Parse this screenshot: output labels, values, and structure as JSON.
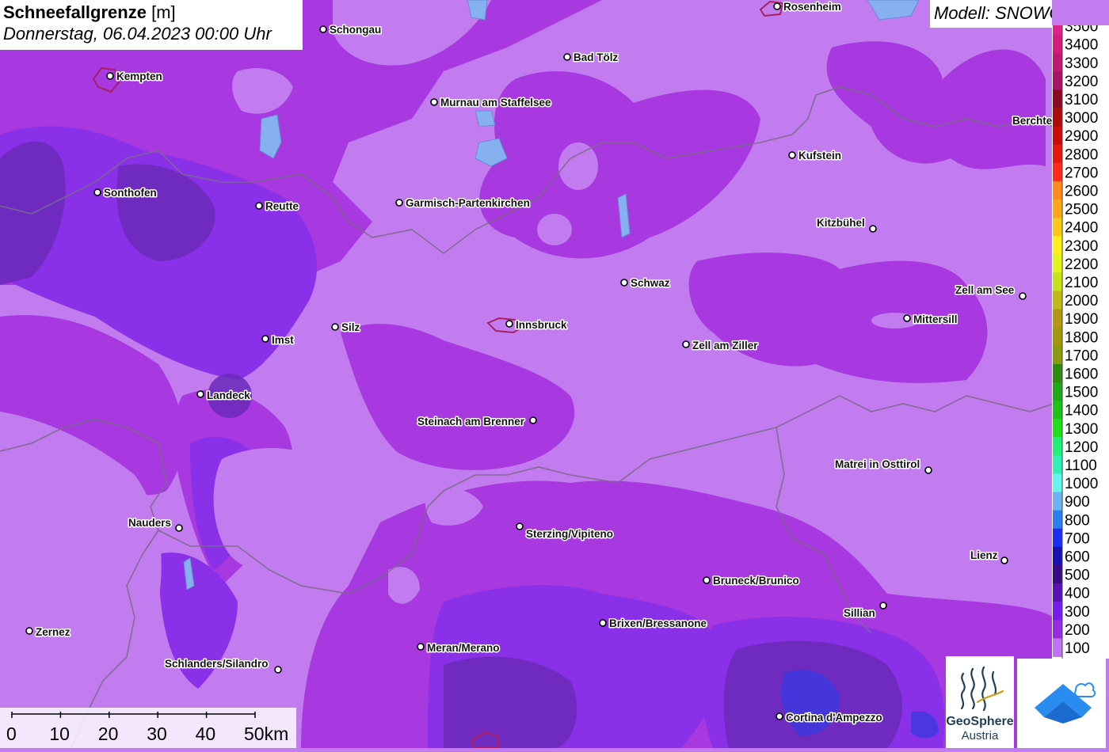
{
  "header": {
    "title": "Schneefallgrenze",
    "unit": "[m]",
    "date": "Donnerstag, 06.04.2023 00:00 Uhr",
    "model": "Modell: SNOWGRID"
  },
  "legend": {
    "entries": [
      {
        "label": "3500",
        "color": "#e0218a"
      },
      {
        "label": "3400",
        "color": "#d41c7f"
      },
      {
        "label": "3300",
        "color": "#c21675"
      },
      {
        "label": "3200",
        "color": "#a8126a"
      },
      {
        "label": "3100",
        "color": "#8c0a20"
      },
      {
        "label": "3000",
        "color": "#ad0b0b"
      },
      {
        "label": "2900",
        "color": "#cc0a0a"
      },
      {
        "label": "2800",
        "color": "#e5170f"
      },
      {
        "label": "2700",
        "color": "#ff2a1a"
      },
      {
        "label": "2600",
        "color": "#ff8a1a"
      },
      {
        "label": "2500",
        "color": "#ffa51a"
      },
      {
        "label": "2400",
        "color": "#ffc71a"
      },
      {
        "label": "2300",
        "color": "#ffee1a"
      },
      {
        "label": "2200",
        "color": "#e2f51a"
      },
      {
        "label": "2100",
        "color": "#c8e21a"
      },
      {
        "label": "2000",
        "color": "#c2b81a"
      },
      {
        "label": "1900",
        "color": "#b69512"
      },
      {
        "label": "1800",
        "color": "#a2970f"
      },
      {
        "label": "1700",
        "color": "#8c9a0f"
      },
      {
        "label": "1600",
        "color": "#2f8a12"
      },
      {
        "label": "1500",
        "color": "#1fa81a"
      },
      {
        "label": "1400",
        "color": "#1ec21a"
      },
      {
        "label": "1300",
        "color": "#1fe01a"
      },
      {
        "label": "1200",
        "color": "#20f07a"
      },
      {
        "label": "1100",
        "color": "#30f0b8"
      },
      {
        "label": "1000",
        "color": "#66f5ef"
      },
      {
        "label": "900",
        "color": "#6ab4f5"
      },
      {
        "label": "800",
        "color": "#2a7ef0"
      },
      {
        "label": "700",
        "color": "#1a2ef5"
      },
      {
        "label": "600",
        "color": "#1a10b0"
      },
      {
        "label": "500",
        "color": "#3a0a8a"
      },
      {
        "label": "400",
        "color": "#5a12b8"
      },
      {
        "label": "300",
        "color": "#7a1af0"
      },
      {
        "label": "200",
        "color": "#9a2ae0"
      },
      {
        "label": "100",
        "color": "#bf72f5"
      }
    ]
  },
  "towns": [
    {
      "name": "Kempten"
    },
    {
      "name": "Schongau"
    },
    {
      "name": "Bad Tölz"
    },
    {
      "name": "Rosenheim"
    },
    {
      "name": "Murnau am Staffelsee"
    },
    {
      "name": "Berchte"
    },
    {
      "name": "Kufstein"
    },
    {
      "name": "Sonthofen"
    },
    {
      "name": "Reutte"
    },
    {
      "name": "Garmisch-Partenkirchen"
    },
    {
      "name": "Kitzbühel"
    },
    {
      "name": "Schwaz"
    },
    {
      "name": "Zell am See"
    },
    {
      "name": "Mittersill"
    },
    {
      "name": "Silz"
    },
    {
      "name": "Innsbruck"
    },
    {
      "name": "Imst"
    },
    {
      "name": "Zell am Ziller"
    },
    {
      "name": "Landeck"
    },
    {
      "name": "Steinach am Brenner"
    },
    {
      "name": "Matrei in Osttirol"
    },
    {
      "name": "Nauders"
    },
    {
      "name": "Sterzing/Vipiteno"
    },
    {
      "name": "Lienz"
    },
    {
      "name": "Bruneck/Brunico"
    },
    {
      "name": "Sillian"
    },
    {
      "name": "Brixen/Bressanone"
    },
    {
      "name": "Zernez"
    },
    {
      "name": "Meran/Merano"
    },
    {
      "name": "Schlanders/Silandro"
    },
    {
      "name": "Cortina d'Ampezzo"
    }
  ],
  "scale": {
    "ticks": [
      "0",
      "10",
      "20",
      "30",
      "40",
      "50km"
    ]
  },
  "logos": {
    "geosphere_line1": "GeoSphere",
    "geosphere_line2": "Austria"
  },
  "colors": {
    "base": "#c27cf0",
    "mid": "#a838e0",
    "deep": "#8a30e8",
    "dark": "#6a2ab8",
    "lake": "#86b0f0",
    "border": "#7a6a8a",
    "city_outline": "#a82060",
    "logo_blue": "#2a8cf0",
    "logo_navy": "#1f3e58"
  }
}
